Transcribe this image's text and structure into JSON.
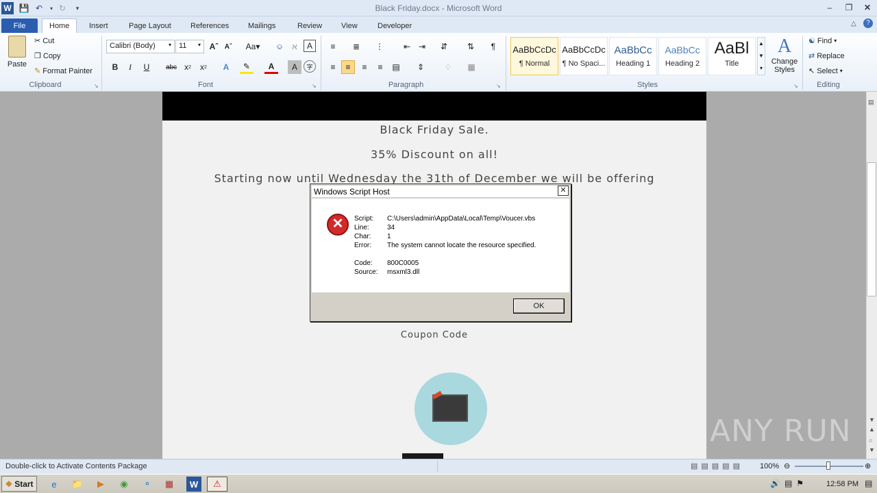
{
  "window": {
    "title": "Black Friday.docx  -  Microsoft Word"
  },
  "tabs": [
    "File",
    "Home",
    "Insert",
    "Page Layout",
    "References",
    "Mailings",
    "Review",
    "View",
    "Developer"
  ],
  "clipboard": {
    "paste": "Paste",
    "cut": "Cut",
    "copy": "Copy",
    "format_painter": "Format Painter",
    "label": "Clipboard"
  },
  "font": {
    "family": "Calibri (Body)",
    "size": "11",
    "label": "Font"
  },
  "paragraph": {
    "label": "Paragraph"
  },
  "styles": {
    "items": [
      {
        "sample": "AaBbCcDc",
        "name": "¶ Normal"
      },
      {
        "sample": "AaBbCcDc",
        "name": "¶ No Spaci..."
      },
      {
        "sample": "AaBbCc",
        "name": "Heading 1"
      },
      {
        "sample": "AaBbCc",
        "name": "Heading 2"
      },
      {
        "sample": "AaBl",
        "name": "Title"
      }
    ],
    "change": "Change Styles",
    "label": "Styles"
  },
  "editing": {
    "find": "Find",
    "replace": "Replace",
    "select": "Select",
    "label": "Editing"
  },
  "document": {
    "line1": "Black Friday Sale.",
    "line2": "35% Discount on all!",
    "line3": "Starting now until Wednesday the 31th of December we will be offering",
    "coupon": "Coupon Code"
  },
  "dialog": {
    "title": "Windows Script Host",
    "rows": [
      {
        "k": "Script:",
        "v": "C:\\Users\\admin\\AppData\\Local\\Temp\\Voucer.vbs"
      },
      {
        "k": "Line:",
        "v": "34"
      },
      {
        "k": "Char:",
        "v": "1"
      },
      {
        "k": "Error:",
        "v": "The system cannot locate the resource specified."
      },
      {
        "k": "Code:",
        "v": "800C0005"
      },
      {
        "k": "Source:",
        "v": "msxml3.dll"
      }
    ],
    "ok": "OK"
  },
  "statusbar": {
    "text": "Double-click to Activate Contents Package",
    "zoom": "100%"
  },
  "taskbar": {
    "start": "Start",
    "clock": "12:58 PM"
  },
  "watermark": "ANY RUN",
  "colors": {
    "file_tab": "#2a5db0",
    "error_red": "#d42a2a",
    "coupon_circle": "#a9d8df"
  }
}
